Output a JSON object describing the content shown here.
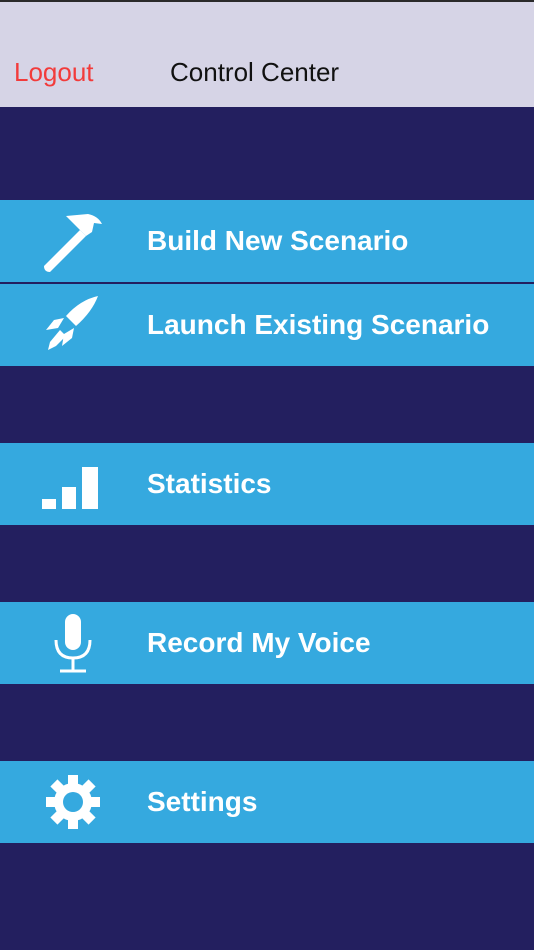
{
  "navbar": {
    "logout_label": "Logout",
    "title": "Control Center"
  },
  "menu": {
    "items": [
      {
        "label": "Build New Scenario",
        "icon": "hammer-icon"
      },
      {
        "label": "Launch Existing Scenario",
        "icon": "rocket-icon"
      },
      {
        "label": "Statistics",
        "icon": "bar-chart-icon"
      },
      {
        "label": "Record My Voice",
        "icon": "microphone-icon"
      },
      {
        "label": "Settings",
        "icon": "gear-icon"
      }
    ]
  },
  "colors": {
    "background": "#231f5f",
    "menu_item": "#35a9df",
    "navbar": "#d6d4e6",
    "logout": "#f23b3b"
  }
}
